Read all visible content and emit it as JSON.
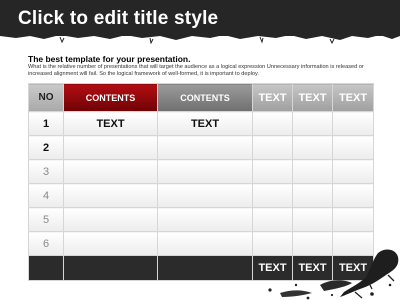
{
  "slide": {
    "title": "Click to edit title style",
    "subtitle": "The best template for your presentation.",
    "description": "What is the relative number of presentations that will target the audience as a logical expression Unnecessary information is released or increased alignment will fail. So the logical framework of well-formed, it is important to deploy."
  },
  "table": {
    "headers": [
      "NO",
      "CONTENTS",
      "CONTENTS",
      "TEXT",
      "TEXT",
      "TEXT"
    ],
    "rows": [
      {
        "no": "1",
        "cells": [
          "TEXT",
          "TEXT",
          "",
          "",
          ""
        ]
      },
      {
        "no": "2",
        "cells": [
          "",
          "",
          "",
          "",
          ""
        ]
      },
      {
        "no": "3",
        "cells": [
          "",
          "",
          "",
          "",
          ""
        ]
      },
      {
        "no": "4",
        "cells": [
          "",
          "",
          "",
          "",
          ""
        ]
      },
      {
        "no": "5",
        "cells": [
          "",
          "",
          "",
          "",
          ""
        ]
      },
      {
        "no": "6",
        "cells": [
          "",
          "",
          "",
          "",
          ""
        ]
      }
    ],
    "footer": [
      "",
      "",
      "",
      "TEXT",
      "TEXT",
      "TEXT"
    ]
  },
  "colors": {
    "banner": "#262626",
    "accent_red": "#b30d12",
    "header_gray": "#8a8a8a",
    "footer_dark": "#2b2b2b"
  }
}
